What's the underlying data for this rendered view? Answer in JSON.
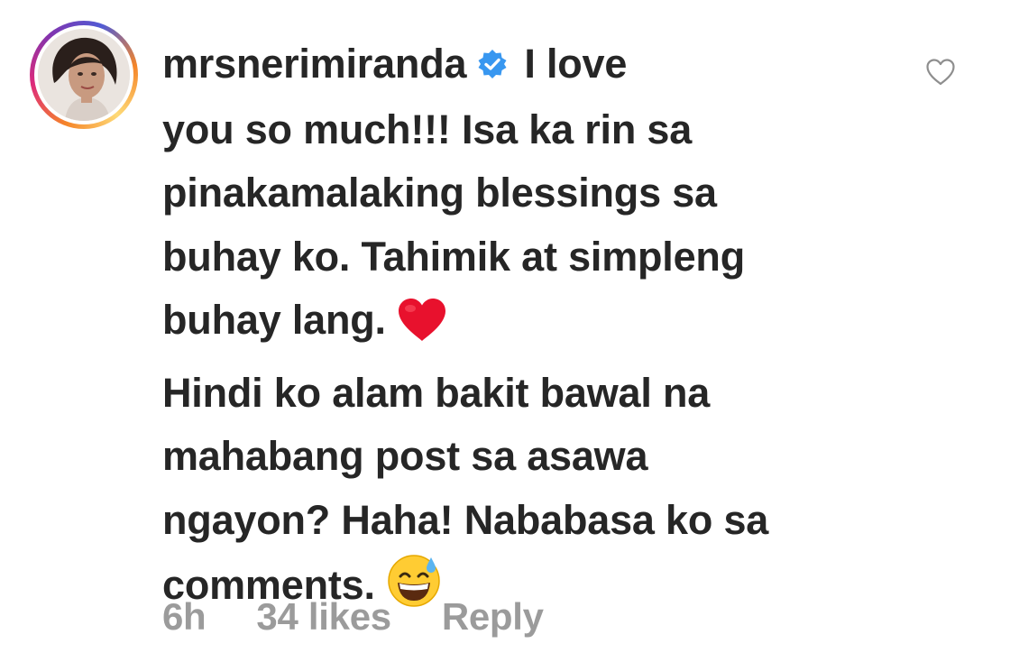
{
  "comment": {
    "username": "mrsnerimiranda",
    "verified_icon": "verified-badge-icon",
    "text_line1": "I love",
    "text_line2": "you so much!!! Isa ka rin sa",
    "text_line3": "pinakamalaking blessings sa",
    "text_line4": "buhay ko. Tahimik at simpleng",
    "text_line5": "buhay lang.",
    "text_line6": "Hindi ko alam bakit bawal na",
    "text_line7": "mahabang post sa asawa",
    "text_line8": "ngayon? Haha! Nababasa ko sa",
    "text_line9": "comments.",
    "emoji_1": "red-heart-emoji",
    "emoji_2": "grinning-sweat-emoji",
    "like_icon": "heart-outline-icon"
  },
  "meta": {
    "time": "6h",
    "likes": "34 likes",
    "reply_label": "Reply"
  },
  "colors": {
    "text": "#262626",
    "meta": "#9b9b9b",
    "verified": "#3897f0",
    "heart_emoji": "#e8112d"
  }
}
